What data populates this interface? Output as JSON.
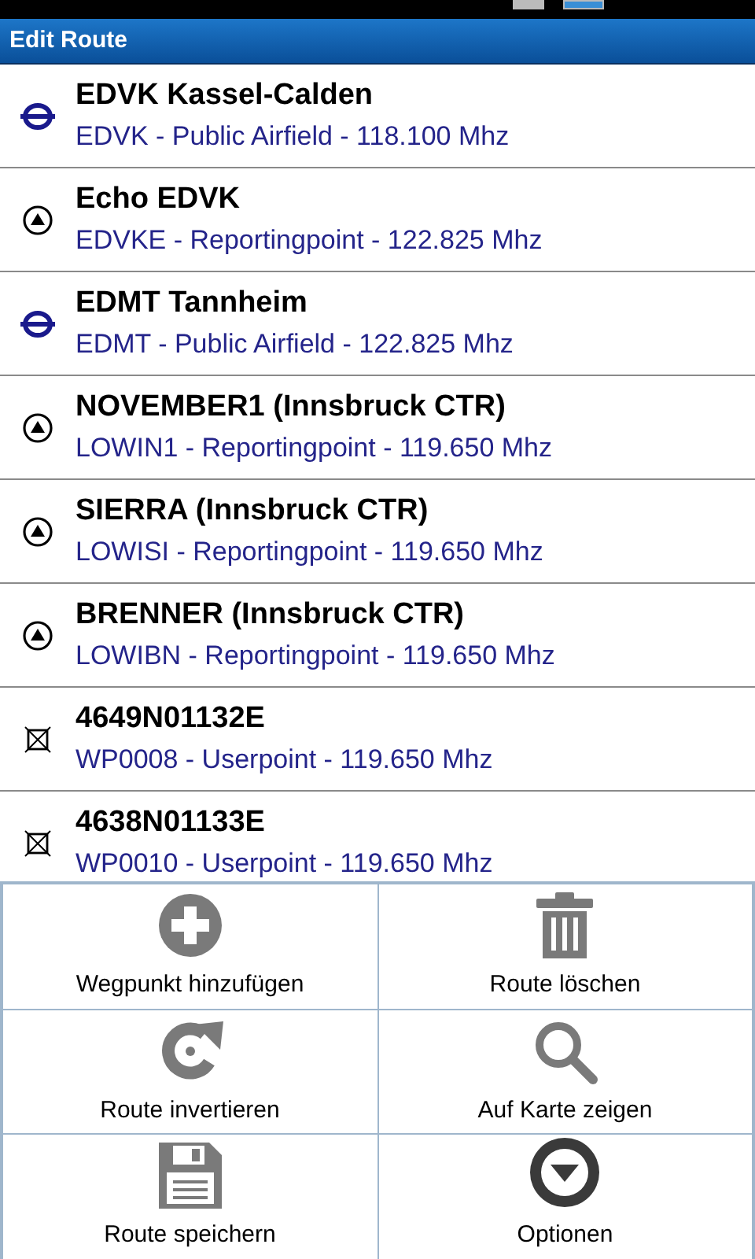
{
  "window": {
    "title": "Edit Route"
  },
  "route": [
    {
      "kind": "airfield",
      "name": "EDVK Kassel-Calden",
      "detail": "EDVK - Public Airfield - 118.100 Mhz"
    },
    {
      "kind": "reporting",
      "name": "Echo EDVK",
      "detail": "EDVKE - Reportingpoint - 122.825 Mhz"
    },
    {
      "kind": "airfield",
      "name": "EDMT Tannheim",
      "detail": "EDMT - Public Airfield - 122.825 Mhz"
    },
    {
      "kind": "reporting",
      "name": "NOVEMBER1 (Innsbruck CTR)",
      "detail": "LOWIN1 - Reportingpoint - 119.650 Mhz"
    },
    {
      "kind": "reporting",
      "name": "SIERRA (Innsbruck CTR)",
      "detail": "LOWISI - Reportingpoint - 119.650 Mhz"
    },
    {
      "kind": "reporting",
      "name": "BRENNER (Innsbruck CTR)",
      "detail": "LOWIBN - Reportingpoint - 119.650 Mhz"
    },
    {
      "kind": "userpoint",
      "name": "4649N01132E",
      "detail": "WP0008 - Userpoint - 119.650 Mhz"
    },
    {
      "kind": "userpoint",
      "name": "4638N01133E",
      "detail": "WP0010 - Userpoint - 119.650 Mhz"
    }
  ],
  "menu": [
    {
      "kind": "add",
      "label": "Wegpunkt hinzufügen"
    },
    {
      "kind": "delete",
      "label": "Route löschen"
    },
    {
      "kind": "invert",
      "label": "Route invertieren"
    },
    {
      "kind": "map",
      "label": "Auf Karte zeigen"
    },
    {
      "kind": "save",
      "label": "Route speichern"
    },
    {
      "kind": "options",
      "label": "Optionen"
    }
  ]
}
